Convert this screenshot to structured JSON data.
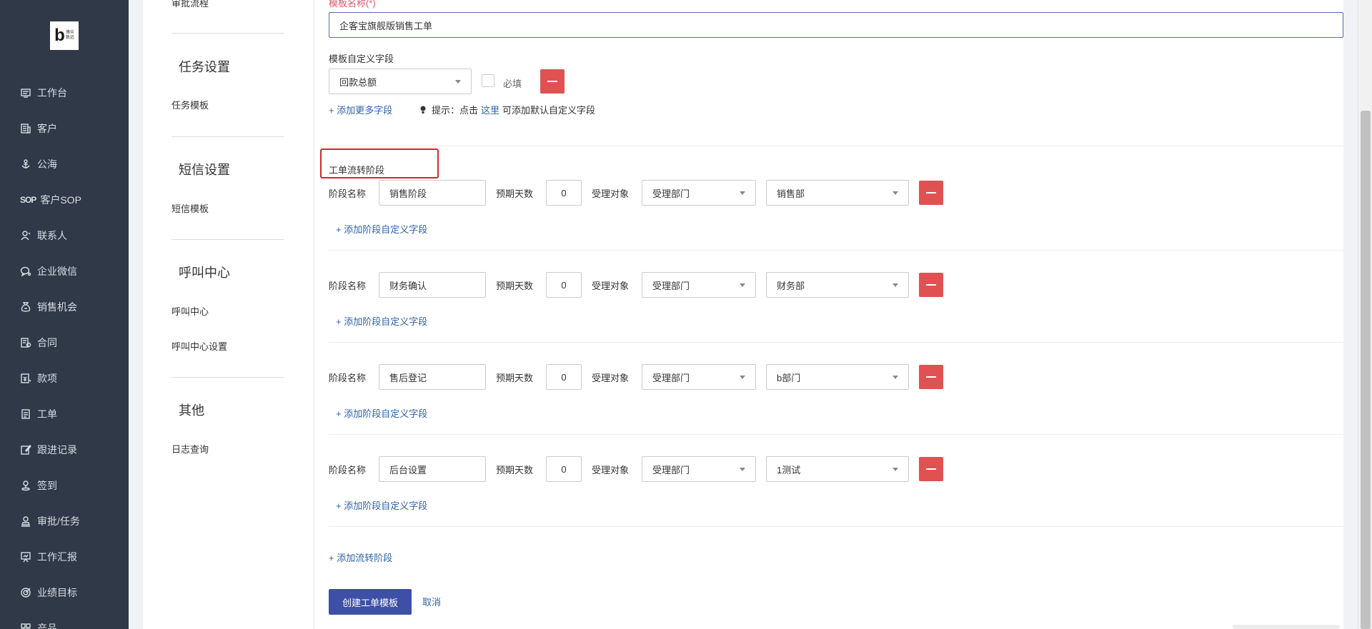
{
  "logo": {
    "mark": "b",
    "line1": "博众",
    "line2": "致远"
  },
  "sidebar": {
    "items": [
      {
        "icon": "monitor-icon",
        "label": "工作台"
      },
      {
        "icon": "building-icon",
        "label": "客户"
      },
      {
        "icon": "anchor-icon",
        "label": "公海"
      },
      {
        "icon": "sop-text-icon",
        "icon_text": "SOP",
        "label": "客户SOP"
      },
      {
        "icon": "user-icon",
        "label": "联系人"
      },
      {
        "icon": "chat-icon",
        "label": "企业微信"
      },
      {
        "icon": "money-bag-icon",
        "label": "销售机会"
      },
      {
        "icon": "contract-icon",
        "label": "合同"
      },
      {
        "icon": "payment-icon",
        "label": "款项"
      },
      {
        "icon": "clipboard-icon",
        "label": "工单"
      },
      {
        "icon": "edit-icon",
        "label": "跟进记录"
      },
      {
        "icon": "location-icon",
        "label": "签到"
      },
      {
        "icon": "approve-icon",
        "label": "审批/任务"
      },
      {
        "icon": "report-icon",
        "label": "工作汇报"
      },
      {
        "icon": "target-icon",
        "label": "业绩目标"
      },
      {
        "icon": "grid-icon",
        "label": "产品"
      }
    ]
  },
  "subnav": {
    "top_item": "审批流程",
    "sections": [
      {
        "heading": "任务设置",
        "links": [
          "任务模板"
        ]
      },
      {
        "heading": "短信设置",
        "links": [
          "短信模板"
        ]
      },
      {
        "heading": "呼叫中心",
        "links": [
          "呼叫中心",
          "呼叫中心设置"
        ]
      },
      {
        "heading": "其他",
        "links": [
          "日志查询"
        ]
      }
    ]
  },
  "form": {
    "template_name_label": "模板名称(*)",
    "template_name_value": "企客宝旗舰版销售工单",
    "custom_fields_label": "模板自定义字段",
    "custom_field_select": "回款总额",
    "required_label": "必填",
    "add_more_fields": "+ 添加更多字段",
    "hint_prefix": "提示：点击",
    "hint_link": "这里",
    "hint_suffix": "可添加默认自定义字段",
    "stages_title": "工单流转阶段",
    "stage_name_label": "阶段名称",
    "expected_days_label": "预期天数",
    "handler_label": "受理对象",
    "add_stage_field": "+ 添加阶段自定义字段",
    "stages": [
      {
        "name": "销售阶段",
        "days": "0",
        "handler_type": "受理部门",
        "department": "销售部"
      },
      {
        "name": "财务确认",
        "days": "0",
        "handler_type": "受理部门",
        "department": "财务部"
      },
      {
        "name": "售后登记",
        "days": "0",
        "handler_type": "受理部门",
        "department": "b部门"
      },
      {
        "name": "后台设置",
        "days": "0",
        "handler_type": "受理部门",
        "department": "1测试"
      }
    ],
    "add_stage": "+ 添加流转阶段",
    "submit": "创建工单模板",
    "cancel": "取消"
  },
  "colors": {
    "sidebar_bg": "#2f3947",
    "primary": "#3e50a6",
    "link": "#2e63a9",
    "danger": "#e05252",
    "highlight_border": "#d9232f"
  }
}
